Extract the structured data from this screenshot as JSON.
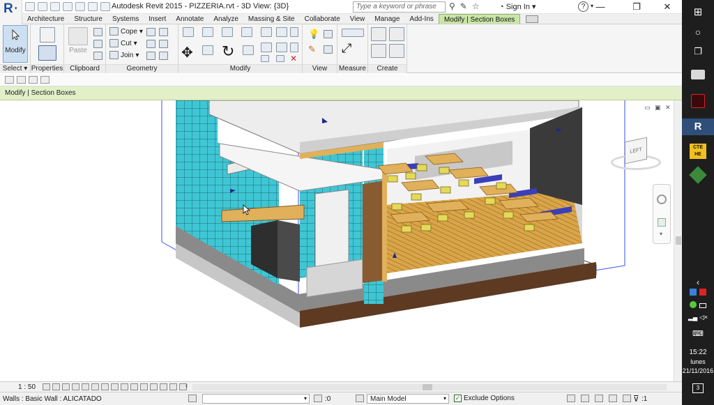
{
  "window": {
    "title": "Autodesk Revit 2015 -    PIZZERIA.rvt - 3D View: {3D}",
    "search_placeholder": "Type a keyword or phrase",
    "sign_in": "Sign In",
    "help": "?"
  },
  "tabs": [
    "Architecture",
    "Structure",
    "Systems",
    "Insert",
    "Annotate",
    "Analyze",
    "Massing & Site",
    "Collaborate",
    "View",
    "Manage",
    "Add-Ins",
    "Modify | Section Boxes"
  ],
  "ribbon": {
    "modify_label": "Modify",
    "select_label": "Select",
    "properties_label": "Properties",
    "paste_label": "Paste",
    "clipboard_label": "Clipboard",
    "cope_label": "Cope",
    "cut_label": "Cut",
    "join_label": "Join",
    "geometry_label": "Geometry",
    "modify_panel_label": "Modify",
    "view_label": "View",
    "measure_label": "Measure",
    "create_label": "Create"
  },
  "context_bar": "Modify | Section Boxes",
  "viewcube": {
    "face": "LEFT"
  },
  "viewbar": {
    "scale": "1 : 50"
  },
  "status": {
    "selection": "Walls : Basic Wall : ALICATADO",
    "count": ":0",
    "workset": "Main Model",
    "exclude_options": "Exclude Options",
    "filter_count": ":1"
  },
  "taskbar": {
    "time": "15:22",
    "day": "lunes",
    "date": "21/11/2016",
    "notifications": "3",
    "cte_label": "CTE\nHE"
  },
  "colors": {
    "tab_active": "#c9e6a6",
    "context_bar": "#e2efc8",
    "tile": "#3fc6d4",
    "wood": "#e0b05a",
    "chair": "#e5d95a",
    "bench": "#3b3fb8",
    "section_box": "#3a4cf0"
  }
}
